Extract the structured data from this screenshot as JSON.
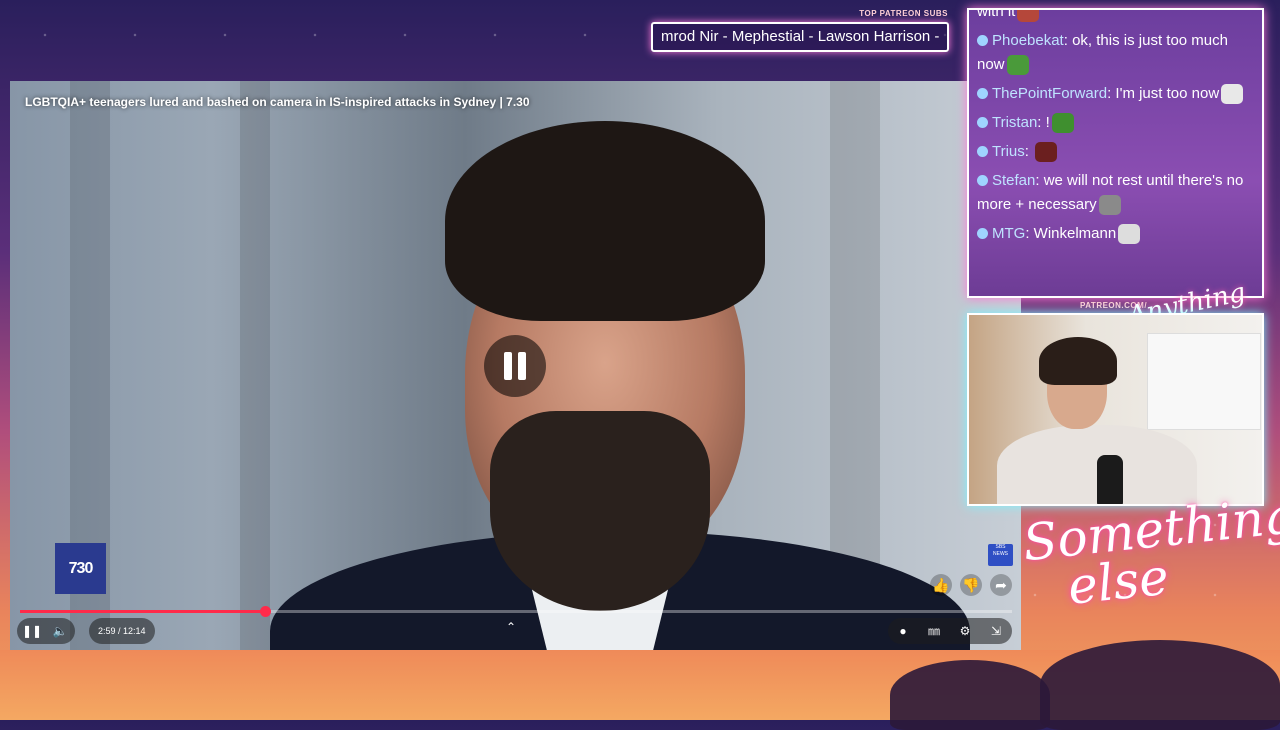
{
  "overlay": {
    "top_subs_label": "TOP PATREON SUBS",
    "top_subs_names": "mrod Nir - Mephestial - Lawson Harrison -",
    "patreon_label": "PATREON.COM/",
    "cam_sign": "Anything else",
    "script_title_line1": "Something",
    "script_title_line2": "else"
  },
  "video": {
    "title": "LGBTQIA+ teenagers lured and bashed on camera in IS-inspired attacks in Sydney | 7.30",
    "channel_logo": "730",
    "news_logo": "SBS NEWS",
    "progress_fraction": 0.247,
    "time_display": "2:59 / 12:14"
  },
  "chat": {
    "messages": [
      {
        "user": "",
        "text": "with it",
        "partial": true
      },
      {
        "user": "Phoebekat",
        "text": "ok, this is just too much now"
      },
      {
        "user": "ThePointForward",
        "text": "I'm just too  now"
      },
      {
        "user": "Tristan",
        "text": "!"
      },
      {
        "user": "Trius",
        "text": ""
      },
      {
        "user": "Stefan",
        "text": "we will not rest until there's no more + necessary"
      },
      {
        "user": "MTG",
        "text": "Winkelmann"
      }
    ]
  },
  "colors": {
    "accent_pink": "#ff7ad9",
    "progress_red": "#ff2a4a",
    "username_blue": "#bfe3ff"
  }
}
